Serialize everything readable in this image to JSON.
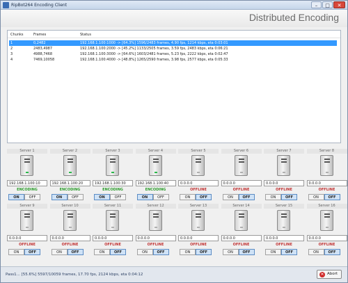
{
  "window": {
    "title": "RipBot264 Encoding Client",
    "header": "Distributed Encoding"
  },
  "list": {
    "headers": [
      "Chunks",
      "Frames",
      "Status"
    ],
    "rows": [
      {
        "chunk": "1",
        "frames": "0,2482",
        "status": "192.168.1.100:1000 -> [64.3%] 1596/2483 frames, 4.90 fps, 1214 kbps, eta 0:03:01"
      },
      {
        "chunk": "2",
        "frames": "2483,4987",
        "status": "192.168.1.100:2000 -> [45.2%] 1133/2505 frames, 3.59 fps, 2483 kbps, eta 0:06:21"
      },
      {
        "chunk": "3",
        "frames": "4988,7468",
        "status": "192.168.1.100:3000 -> [64.6%] 1603/2481 frames, 5.23 fps, 2222 kbps, eta 0:02:47"
      },
      {
        "chunk": "4",
        "frames": "7469,10058",
        "status": "192.168.1.100:4000 -> [48.8%] 1265/2590 frames, 3.98 fps, 2577 kbps, eta 0:05:33"
      }
    ]
  },
  "servers": [
    {
      "name": "Server 1",
      "address": "192.168.1.100:10",
      "state": "ENCODING",
      "on": "ON",
      "off": "OFF"
    },
    {
      "name": "Server 2",
      "address": "192.168.1.100:20",
      "state": "ENCODING",
      "on": "ON",
      "off": "OFF"
    },
    {
      "name": "Server 3",
      "address": "192.168.1.100:30",
      "state": "ENCODING",
      "on": "ON",
      "off": "OFF"
    },
    {
      "name": "Server 4",
      "address": "192.168.1.100:40",
      "state": "ENCODING",
      "on": "ON",
      "off": "OFF"
    },
    {
      "name": "Server 5",
      "address": "0.0.0.0",
      "state": "OFFLINE",
      "on": "ON",
      "off": "OFF"
    },
    {
      "name": "Server 6",
      "address": "0.0.0.0",
      "state": "OFFLINE",
      "on": "ON",
      "off": "OFF"
    },
    {
      "name": "Server 7",
      "address": "0.0.0.0",
      "state": "OFFLINE",
      "on": "ON",
      "off": "OFF"
    },
    {
      "name": "Server 8",
      "address": "0.0.0.0",
      "state": "OFFLINE",
      "on": "ON",
      "off": "OFF"
    },
    {
      "name": "Server 9",
      "address": "0.0.0.0",
      "state": "OFFLINE",
      "on": "ON",
      "off": "OFF"
    },
    {
      "name": "Server 10",
      "address": "0.0.0.0",
      "state": "OFFLINE",
      "on": "ON",
      "off": "OFF"
    },
    {
      "name": "Server 11",
      "address": "0.0.0.0",
      "state": "OFFLINE",
      "on": "ON",
      "off": "OFF"
    },
    {
      "name": "Server 12",
      "address": "0.0.0.0",
      "state": "OFFLINE",
      "on": "ON",
      "off": "OFF"
    },
    {
      "name": "Server 13",
      "address": "0.0.0.0",
      "state": "OFFLINE",
      "on": "ON",
      "off": "OFF"
    },
    {
      "name": "Server 14",
      "address": "0.0.0.0",
      "state": "OFFLINE",
      "on": "ON",
      "off": "OFF"
    },
    {
      "name": "Server 15",
      "address": "0.0.0.0",
      "state": "OFFLINE",
      "on": "ON",
      "off": "OFF"
    },
    {
      "name": "Server 16",
      "address": "0.0.0.0",
      "state": "OFFLINE",
      "on": "ON",
      "off": "OFF"
    }
  ],
  "status": {
    "text": "Pass1... [55.6%] 5597/10059 frames, 17.70 fps, 2124 kbps, eta 0:04:12"
  },
  "abort_label": "Abort",
  "icons": {
    "app": "app-icon",
    "minimize": "minimize-icon",
    "maximize": "maximize-icon",
    "close": "close-icon",
    "server": "server-icon",
    "abort": "abort-icon"
  },
  "colors": {
    "encoding": "#2a9b2a",
    "offline": "#c03030",
    "selection": "#3399ff"
  }
}
